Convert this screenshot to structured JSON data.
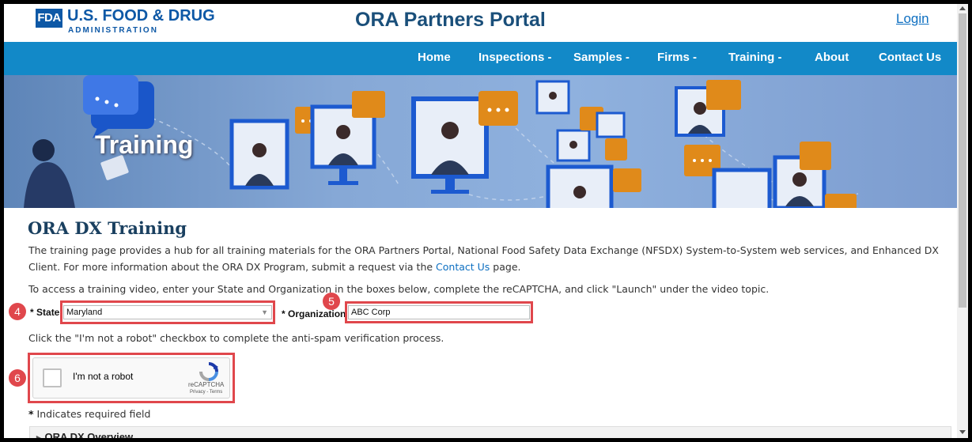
{
  "header": {
    "fda_mark": "FDA",
    "agency_line1": "U.S. FOOD & DRUG",
    "agency_line2": "ADMINISTRATION",
    "portal_title": "ORA Partners Portal",
    "login_label": "Login"
  },
  "nav": {
    "items": [
      {
        "label": "Home"
      },
      {
        "label": "Inspections -"
      },
      {
        "label": "Samples -"
      },
      {
        "label": "Firms -"
      },
      {
        "label": "Training -"
      },
      {
        "label": "About"
      },
      {
        "label": "Contact Us"
      }
    ]
  },
  "banner": {
    "title": "Training"
  },
  "content": {
    "heading": "ORA DX Training",
    "intro_line1": "The training page provides a hub for all training materials for the ORA Partners Portal, National Food Safety Data Exchange (NFSDX) System-to-System web services, and Enhanced DX",
    "intro_line2_pre": "Client. For more information about the ORA DX Program, submit a request via the ",
    "intro_link": "Contact Us",
    "intro_line2_post": " page.",
    "instruction": "To access a training video, enter your State and Organization in the boxes below, complete the reCAPTCHA, and click \"Launch\" under the video topic.",
    "robot_instruction": "Click the \"I'm not a robot\" checkbox to complete the anti-spam verification process.",
    "required_note_star": "*",
    "required_note": " Indicates required field"
  },
  "form": {
    "star": "*",
    "state_label": "State",
    "state_value": "Maryland",
    "org_label": "Organization",
    "org_value": "ABC Corp"
  },
  "captcha": {
    "label": "I'm not a robot",
    "brand": "reCAPTCHA",
    "links": "Privacy - Terms"
  },
  "callouts": {
    "state": "4",
    "org": "5",
    "captcha": "6"
  },
  "accordion": {
    "first_label": "ORA DX Overview"
  },
  "colors": {
    "brand_blue": "#0d58a6",
    "nav_blue": "#1289c8",
    "callout_red": "#e0474c",
    "link_blue": "#0d6fc1"
  }
}
